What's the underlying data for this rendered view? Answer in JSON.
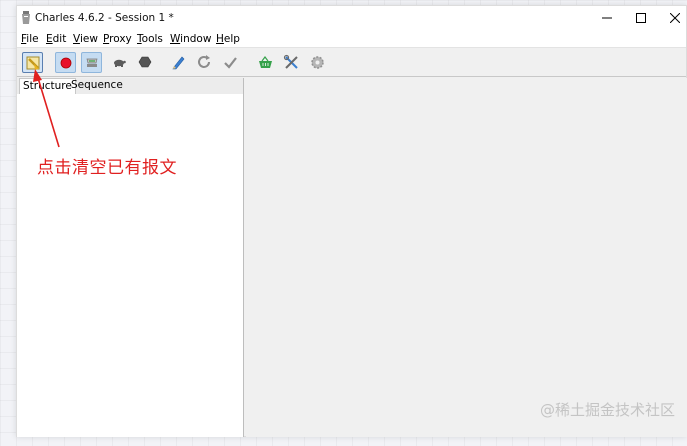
{
  "window": {
    "title": "Charles 4.6.2 - Session 1 *"
  },
  "menubar": {
    "items": [
      "File",
      "Edit",
      "View",
      "Proxy",
      "Tools",
      "Window",
      "Help"
    ]
  },
  "toolbar": {
    "buttons": [
      {
        "icon": "broom-clear-icon",
        "selected": true
      },
      {
        "icon": "record-icon",
        "selected": true
      },
      {
        "icon": "throttle-icon",
        "selected": true
      },
      {
        "icon": "turtle-icon",
        "selected": false
      },
      {
        "icon": "stop-hexagon-icon",
        "selected": false
      },
      {
        "icon": "compose-pen-icon",
        "selected": false
      },
      {
        "icon": "repeat-icon",
        "selected": false
      },
      {
        "icon": "validate-check-icon",
        "selected": false
      },
      {
        "icon": "basket-icon",
        "selected": false
      },
      {
        "icon": "tools-icon",
        "selected": false
      },
      {
        "icon": "settings-gear-icon",
        "selected": false
      }
    ]
  },
  "left_panel": {
    "tabs": [
      {
        "label": "Structure",
        "active": true
      },
      {
        "label": "Sequence",
        "active": false
      }
    ]
  },
  "annotation": {
    "text": "点击清空已有报文",
    "color": "#e02020"
  },
  "watermark": {
    "text": "@稀土掘金技术社区"
  },
  "colors": {
    "record_red": "#e8102a",
    "accent_blue": "#c5dcf2",
    "basket_green": "#35a14a"
  }
}
